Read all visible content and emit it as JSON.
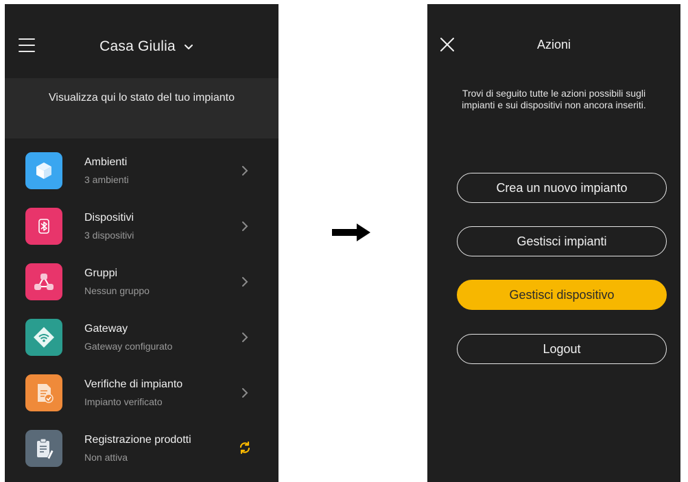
{
  "left_screen": {
    "home_name": "Casa Giulia",
    "status_message": "Visualizza qui lo stato del tuo impianto",
    "items": [
      {
        "label": "Ambienti",
        "sub": "3 ambienti",
        "icon": "cube-icon",
        "color": "#3aa6f0"
      },
      {
        "label": "Dispositivi",
        "sub": "3 dispositivi",
        "icon": "bluetooth-icon",
        "color": "#e8356b"
      },
      {
        "label": "Gruppi",
        "sub": "Nessun gruppo",
        "icon": "groups-icon",
        "color": "#e8356b"
      },
      {
        "label": "Gateway",
        "sub": "Gateway configurato",
        "icon": "wifi-diamond-icon",
        "color": "#2a9d8f"
      },
      {
        "label": "Verifiche di impianto",
        "sub": "Impianto verificato",
        "icon": "checklist-icon",
        "color": "#ef8a3a"
      },
      {
        "label": "Registrazione prodotti",
        "sub": "Non attiva",
        "icon": "clipboard-pen-icon",
        "color": "#5a6a78"
      }
    ],
    "sync_color": "#f7b700"
  },
  "right_screen": {
    "title": "Azioni",
    "description_line1": "Trovi di seguito tutte le azioni possibili sugli",
    "description_line2": "impianti e sui dispositivi non ancora inseriti.",
    "buttons": [
      {
        "label": "Crea un nuovo impianto",
        "primary": false
      },
      {
        "label": "Gestisci impianti",
        "primary": false
      },
      {
        "label": "Gestisci dispositivo",
        "primary": true
      },
      {
        "label": "Logout",
        "primary": false
      }
    ],
    "accent_color": "#f7b700"
  }
}
